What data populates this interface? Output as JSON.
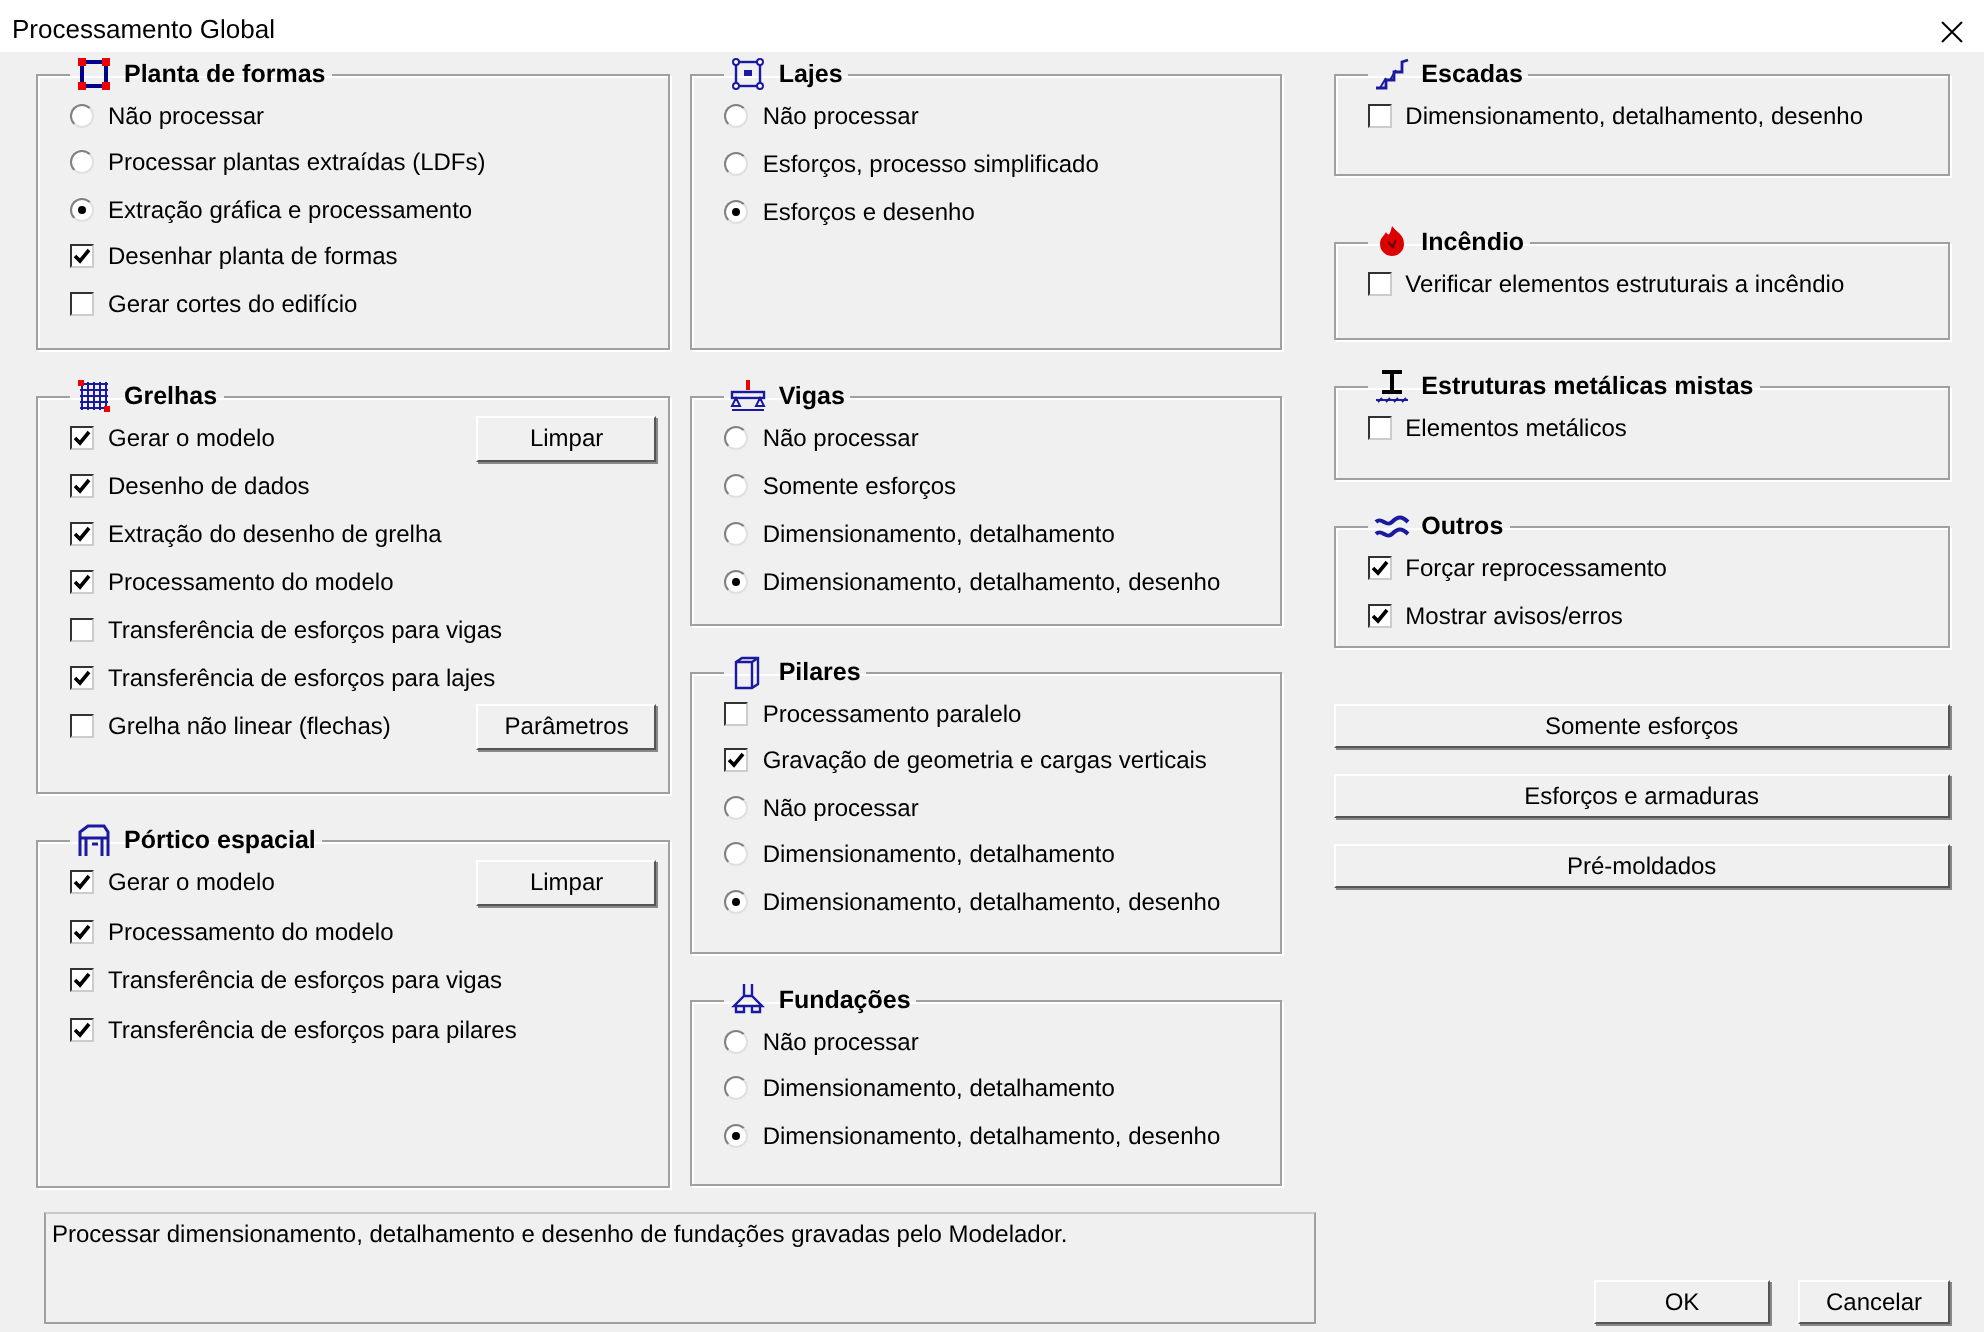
{
  "window": {
    "title": "Processamento Global"
  },
  "columns": [
    {
      "groups": [
        {
          "title": "Planta de formas",
          "items": [
            {
              "kind": "radio",
              "label": "Não processar",
              "selected": false
            },
            {
              "kind": "radio",
              "label": "Processar plantas extraídas (LDFs)",
              "selected": false
            },
            {
              "kind": "radio",
              "label": "Extração gráfica e processamento",
              "selected": true
            },
            {
              "kind": "checkbox",
              "label": "Desenhar planta de formas",
              "checked": true
            },
            {
              "kind": "checkbox",
              "label": "Gerar cortes do edifício",
              "checked": false
            }
          ]
        },
        {
          "title": "Grelhas",
          "items": [
            {
              "kind": "checkbox",
              "label": "Gerar o modelo",
              "checked": true,
              "button": "Limpar"
            },
            {
              "kind": "checkbox",
              "label": "Desenho de dados",
              "checked": true
            },
            {
              "kind": "checkbox",
              "label": "Extração do desenho de grelha",
              "checked": true
            },
            {
              "kind": "checkbox",
              "label": "Processamento do modelo",
              "checked": true
            },
            {
              "kind": "checkbox",
              "label": "Transferência de esforços para vigas",
              "checked": false
            },
            {
              "kind": "checkbox",
              "label": "Transferência de esforços para lajes",
              "checked": true
            },
            {
              "kind": "checkbox",
              "label": "Grelha não linear (flechas)",
              "checked": false,
              "button": "Parâmetros"
            }
          ]
        },
        {
          "title": "Pórtico espacial",
          "items": [
            {
              "kind": "checkbox",
              "label": "Gerar o modelo",
              "checked": true,
              "button": "Limpar"
            },
            {
              "kind": "checkbox",
              "label": "Processamento do modelo",
              "checked": true
            },
            {
              "kind": "checkbox",
              "label": "Transferência de esforços para vigas",
              "checked": true
            },
            {
              "kind": "checkbox",
              "label": "Transferência de esforços para pilares",
              "checked": true
            }
          ]
        }
      ]
    },
    {
      "groups": [
        {
          "title": "Lajes",
          "items": [
            {
              "kind": "radio",
              "label": "Não processar",
              "selected": false
            },
            {
              "kind": "radio",
              "label": "Esforços, processo simplificado",
              "selected": false
            },
            {
              "kind": "radio",
              "label": "Esforços e desenho",
              "selected": true
            }
          ]
        },
        {
          "title": "Vigas",
          "items": [
            {
              "kind": "radio",
              "label": "Não processar",
              "selected": false
            },
            {
              "kind": "radio",
              "label": "Somente esforços",
              "selected": false
            },
            {
              "kind": "radio",
              "label": "Dimensionamento, detalhamento",
              "selected": false
            },
            {
              "kind": "radio",
              "label": "Dimensionamento, detalhamento, desenho",
              "selected": true
            }
          ]
        },
        {
          "title": "Pilares",
          "items": [
            {
              "kind": "checkbox",
              "label": "Processamento paralelo",
              "checked": false
            },
            {
              "kind": "checkbox",
              "label": "Gravação de geometria e cargas verticais",
              "checked": true
            },
            {
              "kind": "radio",
              "label": "Não processar",
              "selected": false
            },
            {
              "kind": "radio",
              "label": "Dimensionamento, detalhamento",
              "selected": false
            },
            {
              "kind": "radio",
              "label": "Dimensionamento, detalhamento, desenho",
              "selected": true
            }
          ]
        },
        {
          "title": "Fundações",
          "items": [
            {
              "kind": "radio",
              "label": "Não processar",
              "selected": false
            },
            {
              "kind": "radio",
              "label": "Dimensionamento, detalhamento",
              "selected": false
            },
            {
              "kind": "radio",
              "label": "Dimensionamento, detalhamento, desenho",
              "selected": true
            }
          ]
        }
      ]
    },
    {
      "groups": [
        {
          "title": "Escadas",
          "items": [
            {
              "kind": "checkbox",
              "label": "Dimensionamento, detalhamento, desenho",
              "checked": false
            }
          ]
        },
        {
          "title": "Incêndio",
          "items": [
            {
              "kind": "checkbox",
              "label": "Verificar elementos estruturais a incêndio",
              "checked": false
            }
          ]
        },
        {
          "title": "Estruturas metálicas mistas",
          "items": [
            {
              "kind": "checkbox",
              "label": "Elementos metálicos",
              "checked": false
            }
          ]
        },
        {
          "title": "Outros",
          "items": [
            {
              "kind": "checkbox",
              "label": "Forçar reprocessamento",
              "checked": true
            },
            {
              "kind": "checkbox",
              "label": "Mostrar avisos/erros",
              "checked": true
            }
          ]
        }
      ]
    }
  ],
  "side_buttons": [
    "Somente esforços",
    "Esforços e armaduras",
    "Pré-moldados"
  ],
  "description": "Processar dimensionamento, detalhamento e desenho de fundações gravadas pelo Modelador.",
  "buttons": [
    "OK",
    "Cancelar"
  ]
}
